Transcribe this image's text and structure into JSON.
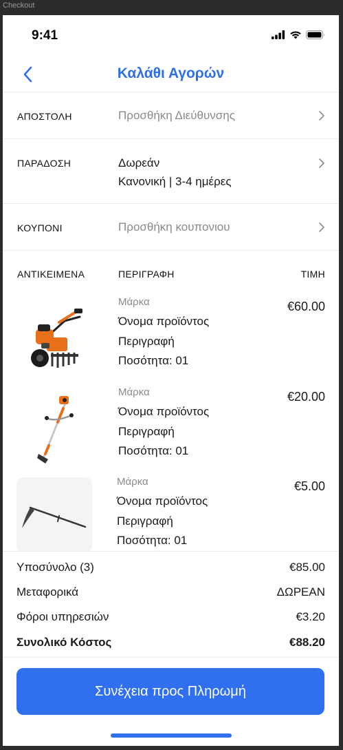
{
  "frame_label": "Checkout",
  "status_bar": {
    "time": "9:41",
    "icons": [
      "signal-icon",
      "wifi-icon",
      "battery-icon"
    ]
  },
  "nav": {
    "back_icon": "chevron-left-icon",
    "title": "Καλάθι Αγορών"
  },
  "shipping": {
    "label": "ΑΠΟΣΤΟΛΗ",
    "value": "Προσθήκη Διεύθυνσης"
  },
  "delivery": {
    "label": "ΠΑΡΑΔΟΣΗ",
    "line1": "Δωρεάν",
    "line2": "Κανονική | 3-4 ημέρες"
  },
  "coupon": {
    "label": "ΚΟΥΠΟΝΙ",
    "value": "Προσθήκη κουπονιου"
  },
  "items_header": {
    "items": "ΑΝΤΙΚΕΙΜΕΝΑ",
    "description": "ΠΕΡΙΓΡΑΦΗ",
    "price": "ΤΙΜΗ"
  },
  "items": [
    {
      "brand": "Μάρκα",
      "name": "Όνομα προϊόντος",
      "description": "Περιγραφή",
      "quantity": "Ποσότητα: 01",
      "price": "€60.00",
      "image": "tiller-image"
    },
    {
      "brand": "Μάρκα",
      "name": "Όνομα προϊόντος",
      "description": "Περιγραφή",
      "quantity": "Ποσότητα: 01",
      "price": "€20.00",
      "image": "brushcutter-image"
    },
    {
      "brand": "Μάρκα",
      "name": "Όνομα προϊόντος",
      "description": "Περιγραφή",
      "quantity": "Ποσότητα: 01",
      "price": "€5.00",
      "image": "scythe-image"
    }
  ],
  "summary": {
    "subtotal_label": "Υποσύνολο (3)",
    "subtotal_value": "€85.00",
    "shipping_label": "Μεταφορικά",
    "shipping_value": "ΔΩΡΕΑΝ",
    "tax_label": "Φόροι υπηρεσιών",
    "tax_value": "€3.20",
    "total_label": "Συνολικό Κόστος",
    "total_value": "€88.20"
  },
  "cta": {
    "label": "Συνέχεια προς Πληρωμή"
  },
  "colors": {
    "accent": "#2f6ff0",
    "title": "#2f6fea",
    "muted": "#8a8a8a"
  }
}
